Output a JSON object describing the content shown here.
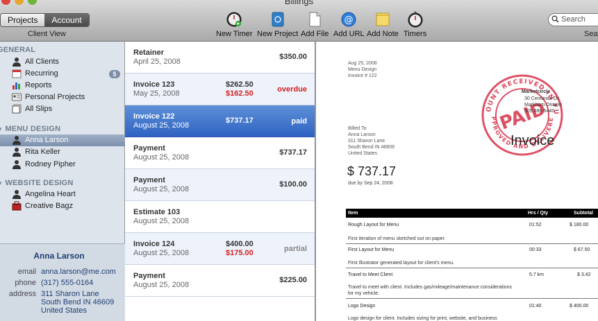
{
  "window": {
    "title": "Billings"
  },
  "toolbar": {
    "segments": [
      {
        "label": "Projects",
        "active": true
      },
      {
        "label": "Account",
        "active": false
      }
    ],
    "segment_caption": "Client View",
    "tools": [
      {
        "label": "New Timer",
        "icon": "timer-icon"
      },
      {
        "label": "New Project",
        "icon": "notebook-icon"
      },
      {
        "label": "Add File",
        "icon": "file-icon"
      },
      {
        "label": "Add URL",
        "icon": "url-icon"
      },
      {
        "label": "Add Note",
        "icon": "note-icon"
      },
      {
        "label": "Timers",
        "icon": "stopwatch-icon"
      }
    ],
    "search_placeholder": "Search",
    "search_caption": "Search"
  },
  "sidebar": {
    "sections": [
      {
        "title": "GENERAL",
        "items": [
          {
            "label": "All Clients",
            "icon": "person-icon"
          },
          {
            "label": "Recurring",
            "icon": "recurring-icon",
            "badge": "5"
          },
          {
            "label": "Reports",
            "icon": "chart-icon"
          },
          {
            "label": "Personal Projects",
            "icon": "id-card-icon"
          },
          {
            "label": "All Slips",
            "icon": "slips-icon"
          }
        ]
      },
      {
        "title": "MENU DESIGN",
        "items": [
          {
            "label": "Anna Larson",
            "icon": "person-icon",
            "selected": true
          },
          {
            "label": "Rita Keller",
            "icon": "person-icon"
          },
          {
            "label": "Rodney Pipher",
            "icon": "person-icon"
          }
        ]
      },
      {
        "title": "WEBSITE DESIGN",
        "items": [
          {
            "label": "Angelina Heart",
            "icon": "person-icon"
          },
          {
            "label": "Creative Bagz",
            "icon": "company-icon"
          }
        ]
      }
    ],
    "contact": {
      "name": "Anna Larson",
      "email_label": "email",
      "email": "anna.larson@me.com",
      "phone_label": "phone",
      "phone": "(317) 555-0164",
      "address_label": "address",
      "address_line1": "311 Sharon Lane",
      "address_line2": "South Bend IN 46609",
      "address_line3": "United States"
    }
  },
  "slips": [
    {
      "title": "Retainer",
      "date": "April 25, 2008",
      "amount": "$350.00",
      "status": ""
    },
    {
      "title": "Invoice 123",
      "date": "May 25, 2008",
      "amount": "$262.50",
      "due": "$162.50",
      "status": "overdue"
    },
    {
      "title": "Invoice 122",
      "date": "August 25, 2008",
      "amount": "$737.17",
      "status": "paid",
      "selected": true
    },
    {
      "title": "Payment",
      "date": "August 25, 2008",
      "amount": "$737.17",
      "status": ""
    },
    {
      "title": "Payment",
      "date": "August 25, 2008",
      "amount": "$100.00",
      "status": ""
    },
    {
      "title": "Estimate 103",
      "date": "August 25, 2008",
      "amount": "",
      "status": ""
    },
    {
      "title": "Invoice 124",
      "date": "August 25, 2008",
      "amount": "$400.00",
      "due": "$175.00",
      "status": "partial"
    },
    {
      "title": "Payment",
      "date": "August 25, 2008",
      "amount": "$225.00",
      "status": ""
    }
  ],
  "invoice": {
    "date": "Aug 25, 2008",
    "project": "Menu Design",
    "number": "Invoice # 122",
    "billed_to_label": "Billed To",
    "billed_name": "Anna Larson",
    "billed_street": "311 Sharon Lane",
    "billed_city": "South Bend IN 46609",
    "billed_country": "United States",
    "total": "$ 737.17",
    "due": "due by Sep 24, 2008",
    "company_name": "Marketcircle",
    "company_line1": "30 Centurian Dr.",
    "company_line2": "Markham Ontario",
    "company_line3": "905 886-6440",
    "doc_label": "Invoice",
    "stamp_top": "AMOUNT RECEIVED IN FULL",
    "stamp_bottom": "APPROVED AND DELIVERED",
    "stamp_center": "PAID",
    "table_headers": {
      "item": "Item",
      "qty": "Hrs / Qty",
      "subtotal": "Subtotal"
    },
    "items": [
      {
        "name": "Rough Layout for Menu",
        "qty": "01:52",
        "subtotal": "$ 180.00",
        "desc": "First iteration of menu sketched out on paper."
      },
      {
        "name": "First Layout for Menu",
        "qty": "00:33",
        "subtotal": "$ 67.50",
        "desc": "First Illustrator generated layout for client's menu."
      },
      {
        "name": "Travel to Meet Client",
        "qty": "5.7 km",
        "subtotal": "$ 3.42",
        "desc": "Travel to meet with client. Includes gas/mileage/maintenance considerations for my vehicle."
      },
      {
        "name": "Logo Design",
        "qty": "01:40",
        "subtotal": "$ 400.00",
        "desc": "Logo design for client. Includes sizing for print, website, and business"
      }
    ]
  },
  "colors": {
    "selection": "#3a6fcc",
    "overdue": "#d41f1f",
    "stamp": "#d8324a"
  }
}
